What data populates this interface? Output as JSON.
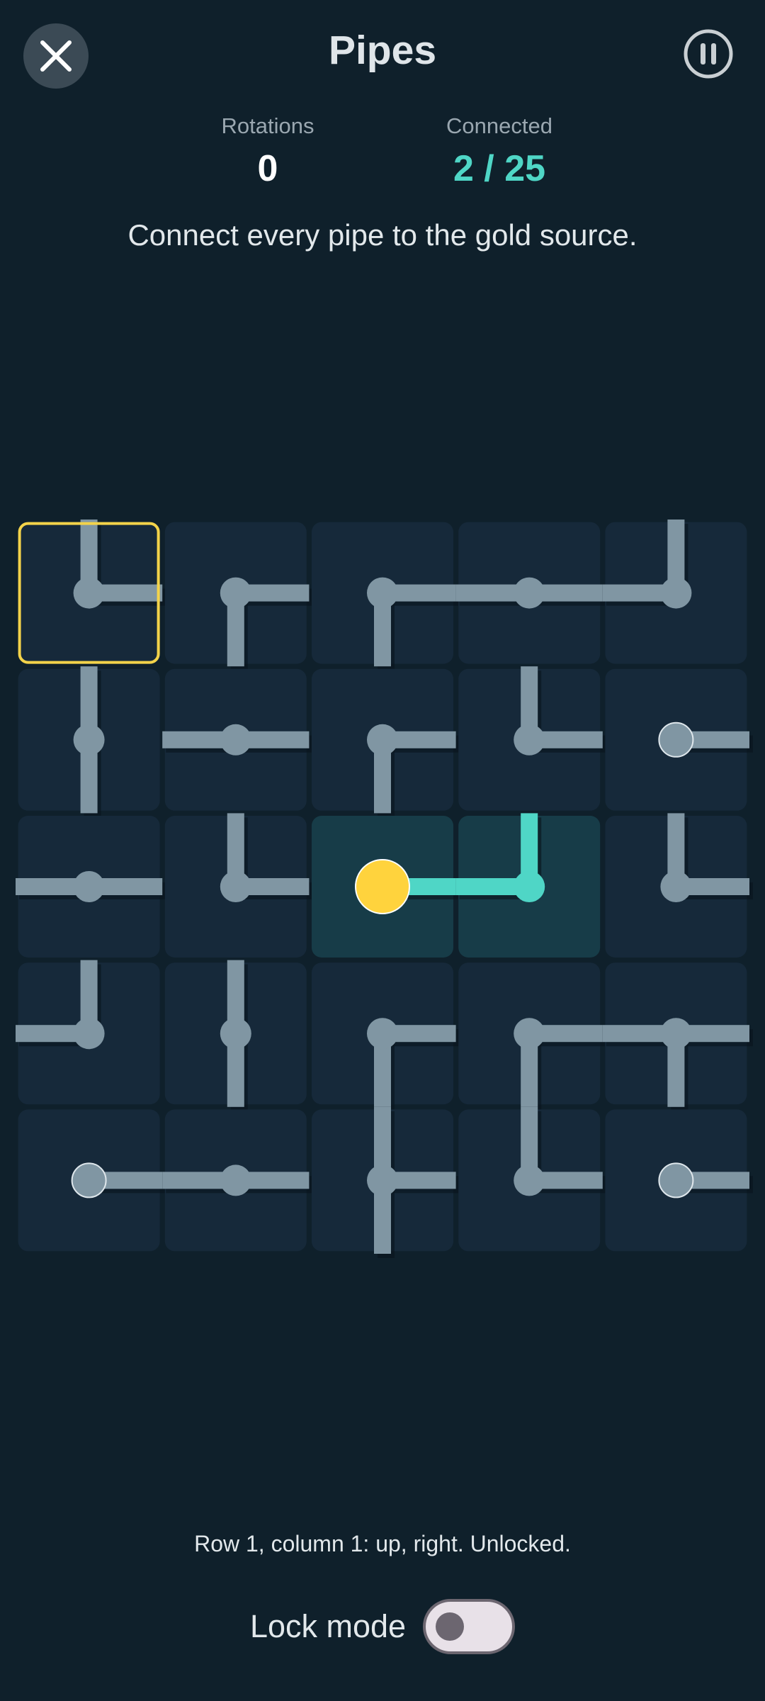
{
  "header": {
    "title": "Pipes",
    "close_icon": "close-icon",
    "pause_icon": "pause-icon"
  },
  "stats": {
    "rotations_label": "Rotations",
    "rotations_value": "0",
    "connected_label": "Connected",
    "connected_value": "2 / 25"
  },
  "instruction": "Connect every pipe to the gold source.",
  "board": {
    "rows": 5,
    "cols": 5,
    "selected": [
      0,
      0
    ],
    "cells": [
      [
        {
          "conn": [
            "up",
            "right"
          ]
        },
        {
          "conn": [
            "right",
            "down"
          ]
        },
        {
          "conn": [
            "right",
            "down"
          ]
        },
        {
          "conn": [
            "left",
            "right"
          ]
        },
        {
          "conn": [
            "up",
            "left"
          ]
        }
      ],
      [
        {
          "conn": [
            "up",
            "down"
          ]
        },
        {
          "conn": [
            "left",
            "right"
          ]
        },
        {
          "conn": [
            "right",
            "down"
          ]
        },
        {
          "conn": [
            "up",
            "right"
          ]
        },
        {
          "conn": [
            "right"
          ],
          "endpoint": true
        }
      ],
      [
        {
          "conn": [
            "left",
            "right"
          ]
        },
        {
          "conn": [
            "up",
            "right"
          ]
        },
        {
          "conn": [
            "right"
          ],
          "source": true,
          "connected": true
        },
        {
          "conn": [
            "up",
            "left"
          ],
          "connected": true
        },
        {
          "conn": [
            "up",
            "right"
          ]
        }
      ],
      [
        {
          "conn": [
            "up",
            "left"
          ]
        },
        {
          "conn": [
            "up",
            "down"
          ]
        },
        {
          "conn": [
            "right",
            "down"
          ]
        },
        {
          "conn": [
            "right",
            "down"
          ]
        },
        {
          "conn": [
            "left",
            "right",
            "down"
          ]
        }
      ],
      [
        {
          "conn": [
            "right"
          ],
          "endpoint": true
        },
        {
          "conn": [
            "left",
            "right"
          ]
        },
        {
          "conn": [
            "up",
            "right",
            "down"
          ]
        },
        {
          "conn": [
            "up",
            "right"
          ]
        },
        {
          "conn": [
            "right"
          ],
          "endpoint": true
        }
      ]
    ]
  },
  "status": "Row 1, column 1: up, right. Unlocked.",
  "lock_mode": {
    "label": "Lock mode",
    "enabled": false
  },
  "colors": {
    "background": "#0f202b",
    "tile": "#16293a",
    "tile_connected": "#173c48",
    "pipe": "#8096a3",
    "pipe_connected": "#4fd6c6",
    "source": "#ffd33d",
    "selection": "#f3d34a"
  }
}
